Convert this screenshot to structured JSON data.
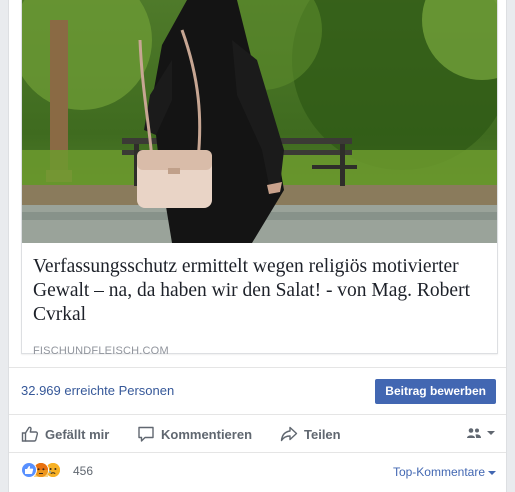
{
  "post": {
    "link": {
      "title": "Verfassungsschutz ermittelt wegen religiös motivierter Gewalt – na, da haben wir den Salat! - von Mag. Robert Cvrkal",
      "domain": "FISCHUNDFLEISCH.COM"
    },
    "reach": {
      "text": "32.969 erreichte Personen",
      "promote_label": "Beitrag bewerben"
    },
    "actions": {
      "like_label": "Gefällt mir",
      "comment_label": "Kommentieren",
      "share_label": "Teilen",
      "audience_icon": "friends-icon"
    },
    "reactions": {
      "types": [
        "like",
        "angry",
        "sad"
      ],
      "count": "456",
      "sort_label": "Top-Kommentare"
    }
  },
  "colors": {
    "link_blue": "#365899",
    "button_blue": "#4267b2",
    "muted_text": "#90949c",
    "action_text": "#606770",
    "like_reaction": "#5890ff",
    "angry_reaction": "#e9710f",
    "sad_reaction": "#f7b125"
  }
}
